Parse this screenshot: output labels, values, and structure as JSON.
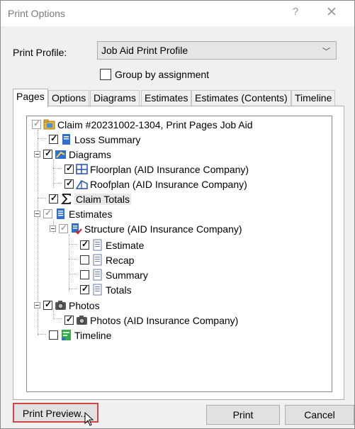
{
  "window": {
    "title": "Print Options",
    "help_label": "?",
    "close_label": "✕"
  },
  "profile": {
    "label": "Print Profile:",
    "value": "Job Aid Print Profile"
  },
  "group_by_assignment": {
    "label": "Group by assignment",
    "checked": false
  },
  "tabs": [
    {
      "label": "Pages",
      "active": true
    },
    {
      "label": "Options"
    },
    {
      "label": "Diagrams"
    },
    {
      "label": "Estimates"
    },
    {
      "label": "Estimates (Contents)"
    },
    {
      "label": "Timeline"
    }
  ],
  "tree": {
    "root": "Claim #20231002-1304, Print Pages Job Aid",
    "loss_summary": "Loss Summary",
    "diagrams": "Diagrams",
    "floorplan": "Floorplan (AID Insurance Company)",
    "roofplan": "Roofplan (AID Insurance Company)",
    "claim_totals": "Claim Totals",
    "estimates": "Estimates",
    "structure": "Structure (AID Insurance Company)",
    "estimate": "Estimate",
    "recap": "Recap",
    "summary": "Summary",
    "totals": "Totals",
    "photos": "Photos",
    "photos_company": "Photos (AID Insurance Company)",
    "timeline": "Timeline"
  },
  "buttons": {
    "print_preview": "Print Preview...",
    "print": "Print",
    "cancel": "Cancel"
  },
  "colors": {
    "highlight_border": "#d64545",
    "tree_border": "#828790"
  }
}
